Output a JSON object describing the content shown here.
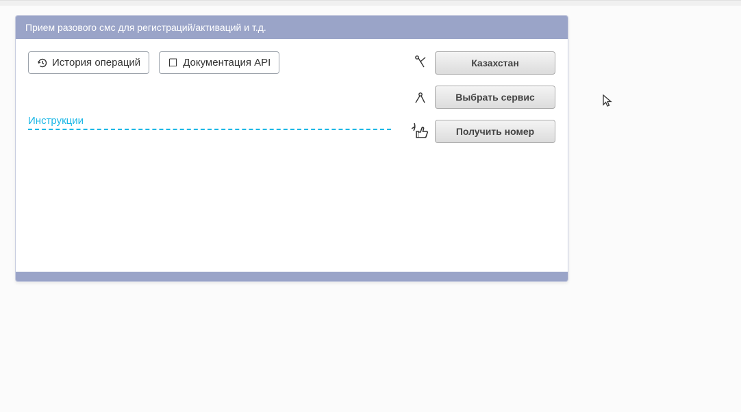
{
  "panel": {
    "title": "Прием разового смс для регистраций/активаций и т.д."
  },
  "topButtons": {
    "history": "История операций",
    "apiDoc": "Документация API"
  },
  "instructions": {
    "label": "Инструкции"
  },
  "steps": {
    "country": "Казахстан",
    "service": "Выбрать сервис",
    "getNumber": "Получить номер"
  }
}
